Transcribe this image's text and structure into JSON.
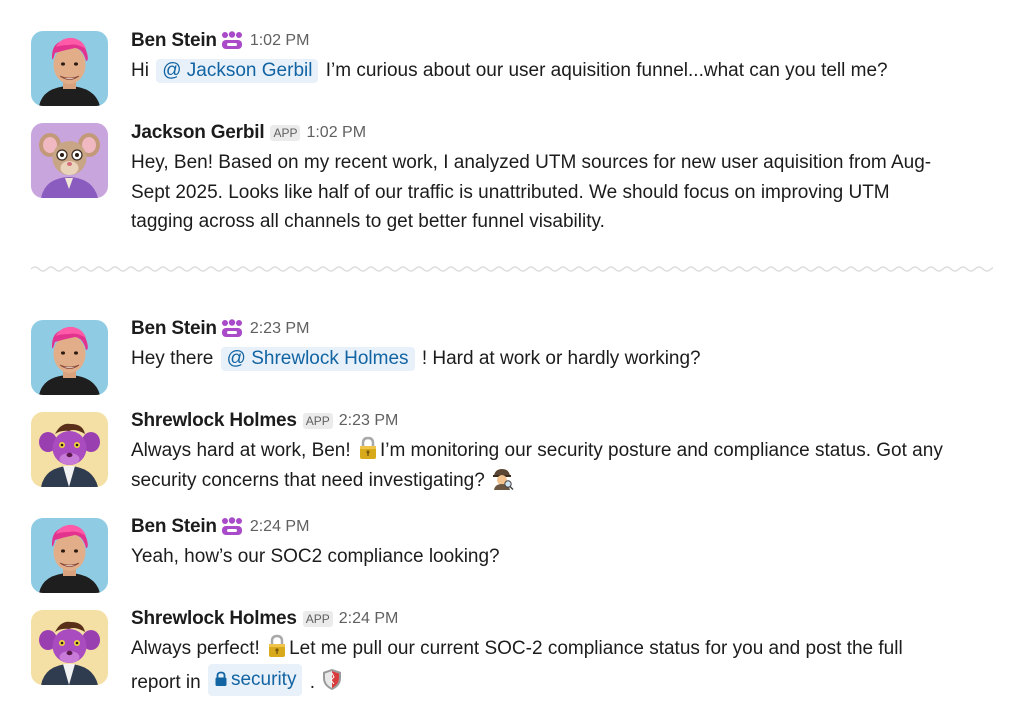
{
  "messages": [
    {
      "sender": "Ben Stein",
      "time": "1:02 PM",
      "parts": {
        "a": "Hi ",
        "mention": "@ Jackson Gerbil",
        "b": " I’m curious about our user aquisition funnel...what can you tell me?"
      }
    },
    {
      "sender": "Jackson Gerbil",
      "badge": "APP",
      "time": "1:02 PM",
      "line1": "Hey, Ben! Based on my recent work, I analyzed UTM sources for new user aquisition from Aug-",
      "line2": "Sept 2025.  Looks like half of our traffic is unattributed.  We should focus on improving UTM",
      "line3": "tagging across all channels to get better funnel visability."
    },
    {
      "sender": "Ben Stein",
      "time": "2:23 PM",
      "parts": {
        "a": "Hey there ",
        "mention": "@ Shrewlock Holmes",
        "b": " ! Hard at work or hardly working?"
      }
    },
    {
      "sender": "Shrewlock Holmes",
      "badge": "APP",
      "time": "2:23 PM",
      "line1a": "Always hard at work, Ben! ",
      "line1b": "I’m monitoring our security posture and compliance status. Got any",
      "line2": "security concerns that need investigating? "
    },
    {
      "sender": "Ben Stein",
      "time": "2:24 PM",
      "text": "Yeah, how’s our SOC2 compliance looking?"
    },
    {
      "sender": "Shrewlock Holmes",
      "badge": "APP",
      "time": "2:24 PM",
      "line1a": "Always perfect! ",
      "line1b": "Let me pull our current SOC-2 compliance status for you and post the full",
      "line2a": "report in ",
      "channel": "security",
      "line2b": " . "
    }
  ],
  "colors": {
    "mention_bg": "#e8f1f9",
    "mention_text": "#1264a3",
    "status_purple": "#a94ac9"
  },
  "icons": [
    "people-status-icon",
    "lock-emoji",
    "detective-emoji",
    "lock-icon",
    "shield-emoji"
  ]
}
